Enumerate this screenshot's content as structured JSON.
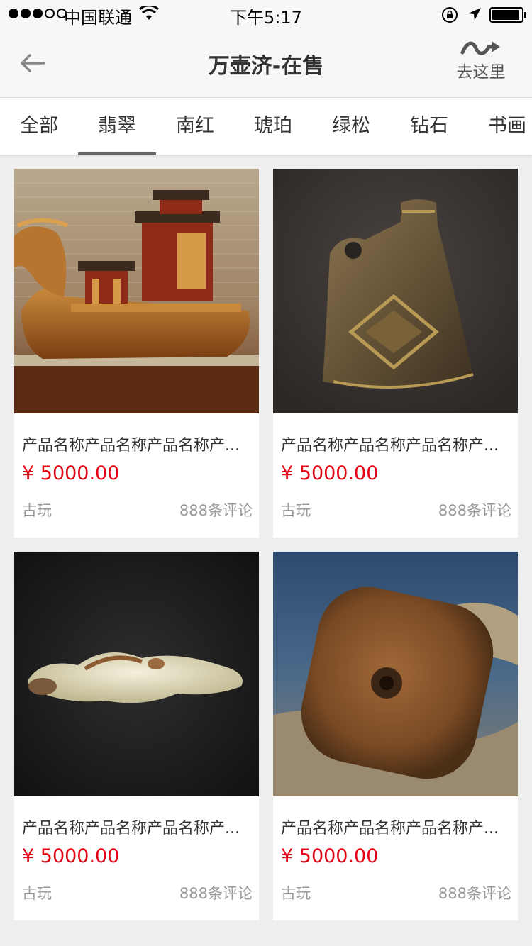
{
  "status_bar": {
    "carrier": "中国联通",
    "time": "下午5:17"
  },
  "nav": {
    "title": "万壶济-在售",
    "go_label": "去这里"
  },
  "tabs": [
    {
      "label": "全部"
    },
    {
      "label": "翡翠"
    },
    {
      "label": "南红"
    },
    {
      "label": "琥珀"
    },
    {
      "label": "绿松"
    },
    {
      "label": "钻石"
    },
    {
      "label": "书画"
    }
  ],
  "active_tab": "翡翠",
  "products": [
    {
      "name": "产品名称产品名称产品名称产...",
      "price": "¥ 5000.00",
      "category": "古玩",
      "comments": "888条评论",
      "image": "dragon-boat-carving"
    },
    {
      "name": "产品名称产品名称产品名称产...",
      "price": "¥ 5000.00",
      "category": "古玩",
      "comments": "888条评论",
      "image": "bronze-flask"
    },
    {
      "name": "产品名称产品名称产品名称产...",
      "price": "¥ 5000.00",
      "category": "古玩",
      "comments": "888条评论",
      "image": "white-jade-bird"
    },
    {
      "name": "产品名称产品名称产品名称产...",
      "price": "¥ 5000.00",
      "category": "古玩",
      "comments": "888条评论",
      "image": "jade-bi-disc-on-wood"
    }
  ],
  "colors": {
    "price": "#e60012",
    "background": "#eeeeee",
    "active_tab_indicator": "#666666"
  }
}
